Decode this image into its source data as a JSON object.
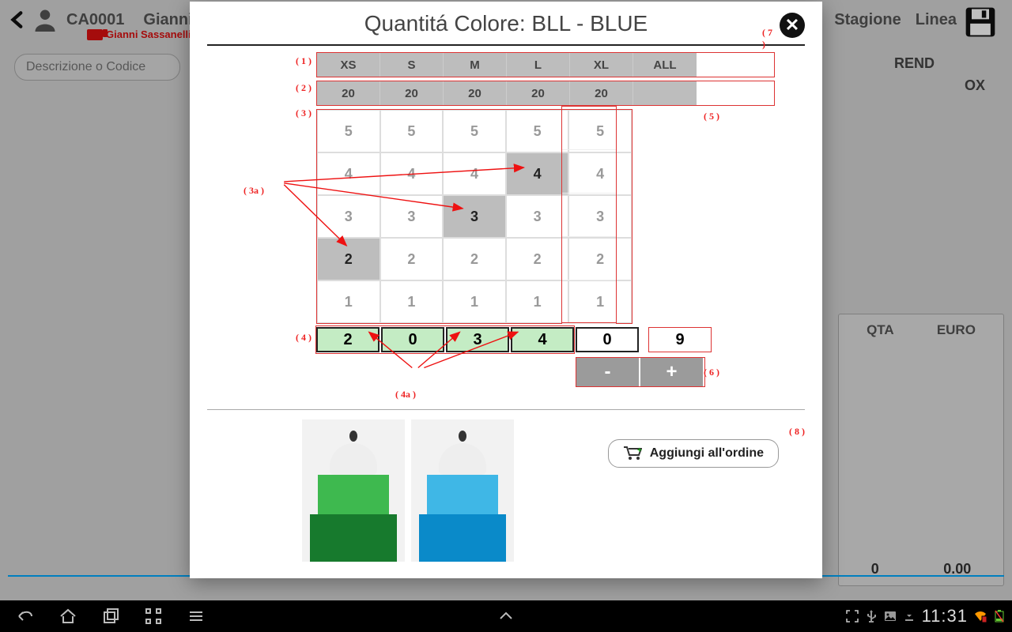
{
  "background": {
    "customer_code": "CA0001",
    "customer_name": "Gianni Sassanelli",
    "ship_to": "Gianni Sassanelli (",
    "season_label": "Stagione",
    "line_label": "Linea",
    "season_value": "REND",
    "line_value": "OX",
    "search_placeholder": "Descrizione o Codice",
    "totals_hdr_qty": "QTA",
    "totals_hdr_eur": "EURO",
    "totals_qty": "0",
    "totals_eur": "0.00"
  },
  "modal": {
    "title": "Quantitá Colore: BLL - BLUE",
    "sizes": [
      "XS",
      "S",
      "M",
      "L",
      "XL",
      "ALL"
    ],
    "stock": [
      "20",
      "20",
      "20",
      "20",
      "20",
      ""
    ],
    "grid": [
      [
        "5",
        "5",
        "5",
        "5",
        "5"
      ],
      [
        "4",
        "4",
        "4",
        "4",
        "4"
      ],
      [
        "3",
        "3",
        "3",
        "3",
        "3"
      ],
      [
        "2",
        "2",
        "2",
        "2",
        "2"
      ],
      [
        "1",
        "1",
        "1",
        "1",
        "1"
      ]
    ],
    "grid_highlights": [
      [
        1,
        3
      ],
      [
        2,
        2
      ],
      [
        3,
        0
      ]
    ],
    "totals_green": [
      "2",
      "0",
      "3",
      "4"
    ],
    "totals_white": [
      "0"
    ],
    "total_sum": "9",
    "minus": "-",
    "plus": "+",
    "add_label": "Aggiungi all'ordine"
  },
  "annotations": {
    "a1": "( 1 )",
    "a2": "( 2 )",
    "a3": "( 3 )",
    "a3a": "( 3a )",
    "a4": "( 4 )",
    "a4a": "( 4a )",
    "a5": "( 5 )",
    "a6": "( 6 )",
    "a7": "( 7 )",
    "a8": "( 8 )"
  },
  "status_bar": {
    "clock": "11:31"
  }
}
